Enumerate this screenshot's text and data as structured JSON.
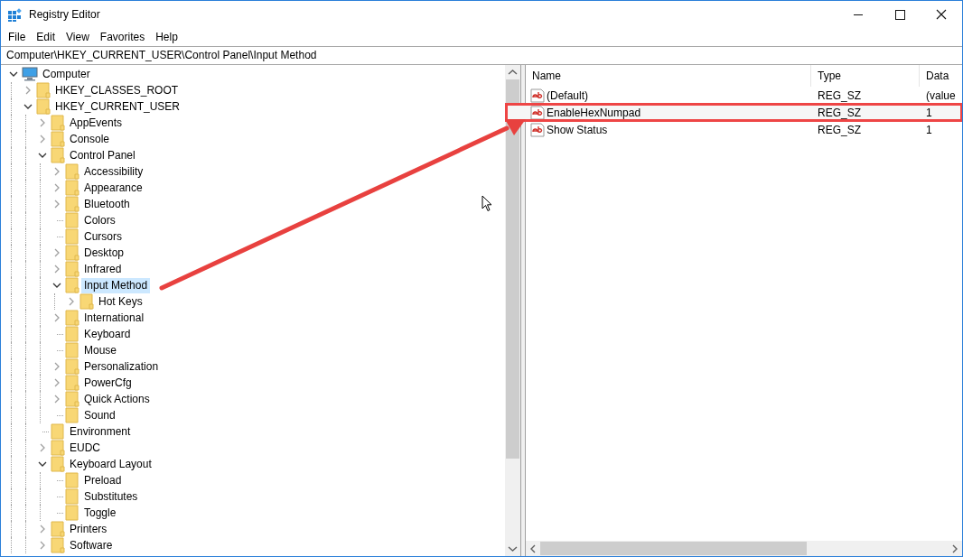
{
  "window": {
    "title": "Registry Editor"
  },
  "menu": [
    "File",
    "Edit",
    "View",
    "Favorites",
    "Help"
  ],
  "address": "Computer\\HKEY_CURRENT_USER\\Control Panel\\Input Method",
  "tree": [
    {
      "label": "Computer",
      "kind": "computer",
      "expanded": true,
      "selected": false,
      "children": [
        {
          "label": "HKEY_CLASSES_ROOT",
          "kind": "key",
          "expanded": false,
          "selected": false
        },
        {
          "label": "HKEY_CURRENT_USER",
          "kind": "key",
          "expanded": true,
          "selected": false,
          "children": [
            {
              "label": "AppEvents",
              "kind": "key",
              "expanded": false,
              "selected": false
            },
            {
              "label": "Console",
              "kind": "key",
              "expanded": false,
              "selected": false
            },
            {
              "label": "Control Panel",
              "kind": "key",
              "expanded": true,
              "selected": false,
              "children": [
                {
                  "label": "Accessibility",
                  "kind": "key",
                  "expanded": false,
                  "selected": false
                },
                {
                  "label": "Appearance",
                  "kind": "key",
                  "expanded": false,
                  "selected": false
                },
                {
                  "label": "Bluetooth",
                  "kind": "key",
                  "expanded": false,
                  "selected": false
                },
                {
                  "label": "Colors",
                  "kind": "leaf",
                  "selected": false
                },
                {
                  "label": "Cursors",
                  "kind": "leaf",
                  "selected": false
                },
                {
                  "label": "Desktop",
                  "kind": "key",
                  "expanded": false,
                  "selected": false
                },
                {
                  "label": "Infrared",
                  "kind": "key",
                  "expanded": false,
                  "selected": false
                },
                {
                  "label": "Input Method",
                  "kind": "key",
                  "expanded": true,
                  "selected": true,
                  "children": [
                    {
                      "label": "Hot Keys",
                      "kind": "key",
                      "expanded": false,
                      "selected": false
                    }
                  ]
                },
                {
                  "label": "International",
                  "kind": "key",
                  "expanded": false,
                  "selected": false
                },
                {
                  "label": "Keyboard",
                  "kind": "leaf",
                  "selected": false
                },
                {
                  "label": "Mouse",
                  "kind": "leaf",
                  "selected": false
                },
                {
                  "label": "Personalization",
                  "kind": "key",
                  "expanded": false,
                  "selected": false
                },
                {
                  "label": "PowerCfg",
                  "kind": "key",
                  "expanded": false,
                  "selected": false
                },
                {
                  "label": "Quick Actions",
                  "kind": "key",
                  "expanded": false,
                  "selected": false
                },
                {
                  "label": "Sound",
                  "kind": "leaf",
                  "selected": false
                }
              ]
            },
            {
              "label": "Environment",
              "kind": "leaf",
              "selected": false
            },
            {
              "label": "EUDC",
              "kind": "key",
              "expanded": false,
              "selected": false
            },
            {
              "label": "Keyboard Layout",
              "kind": "key",
              "expanded": true,
              "selected": false,
              "children": [
                {
                  "label": "Preload",
                  "kind": "leaf",
                  "selected": false
                },
                {
                  "label": "Substitutes",
                  "kind": "leaf",
                  "selected": false
                },
                {
                  "label": "Toggle",
                  "kind": "leaf",
                  "selected": false
                }
              ]
            },
            {
              "label": "Printers",
              "kind": "key",
              "expanded": false,
              "selected": false
            },
            {
              "label": "Software",
              "kind": "key",
              "expanded": false,
              "selected": false
            }
          ]
        }
      ]
    }
  ],
  "values": {
    "columns": [
      "Name",
      "Type",
      "Data"
    ],
    "rows": [
      {
        "name": "(Default)",
        "type": "REG_SZ",
        "data": "(value",
        "annotated": false
      },
      {
        "name": "EnableHexNumpad",
        "type": "REG_SZ",
        "data": "1",
        "annotated": true
      },
      {
        "name": "Show Status",
        "type": "REG_SZ",
        "data": "1",
        "annotated": false
      }
    ]
  }
}
